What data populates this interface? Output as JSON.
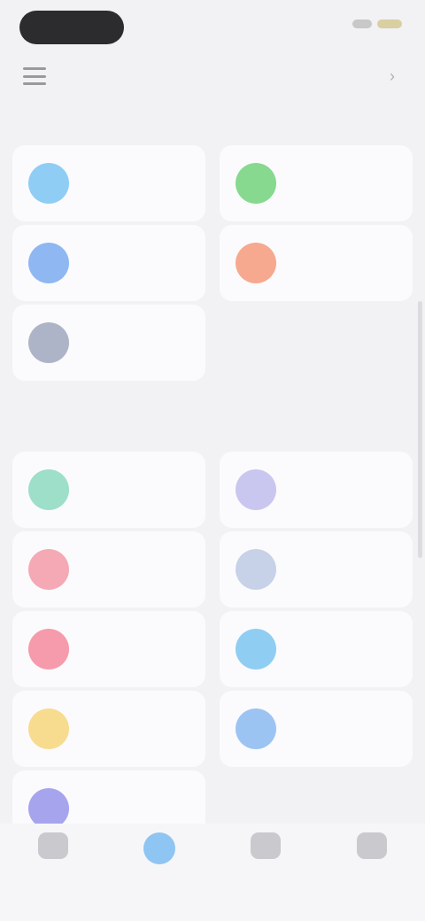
{
  "status_bar": {
    "pill": "",
    "icons": [
      "cellular-icon",
      "battery-icon"
    ]
  },
  "nav": {
    "title": "",
    "menu_icon": "menu-icon",
    "action_icon": "chevron-icon"
  },
  "section1": {
    "caption": "",
    "items": [
      {
        "label": "",
        "color": "#8fcdf5",
        "icon": "user-icon"
      },
      {
        "label": "",
        "color": "#86d98f",
        "icon": "check-icon"
      },
      {
        "label": "",
        "color": "#8fb7f2",
        "icon": "doc-icon"
      },
      {
        "label": "",
        "color": "#f6a98f",
        "icon": "alert-icon"
      },
      {
        "label": "",
        "color": "#aeb4c7",
        "icon": "list-icon"
      }
    ]
  },
  "section2": {
    "title": "",
    "items": [
      {
        "label": "",
        "color": "#9ddfc9",
        "icon": "chart-icon"
      },
      {
        "label": "",
        "color": "#c9c6f0",
        "icon": "calendar-icon"
      },
      {
        "label": "",
        "color": "#f5a9b4",
        "icon": "heart-icon"
      },
      {
        "label": "",
        "color": "#c7d2e8",
        "icon": "clock-icon"
      },
      {
        "label": "",
        "color": "#f59bab",
        "icon": "flag-icon"
      },
      {
        "label": "",
        "color": "#90cdf2",
        "icon": "cloud-icon"
      },
      {
        "label": "",
        "color": "#f7dc8f",
        "icon": "star-icon"
      },
      {
        "label": "",
        "color": "#9cc4f3",
        "icon": "folder-icon"
      },
      {
        "label": "",
        "color": "#a7a4ee",
        "icon": "settings-icon"
      }
    ]
  },
  "tabs": [
    {
      "label": "",
      "icon": "home-icon",
      "active": false
    },
    {
      "label": "",
      "icon": "apps-icon",
      "active": true
    },
    {
      "label": "",
      "icon": "inbox-icon",
      "active": false
    },
    {
      "label": "",
      "icon": "profile-icon",
      "active": false
    }
  ]
}
